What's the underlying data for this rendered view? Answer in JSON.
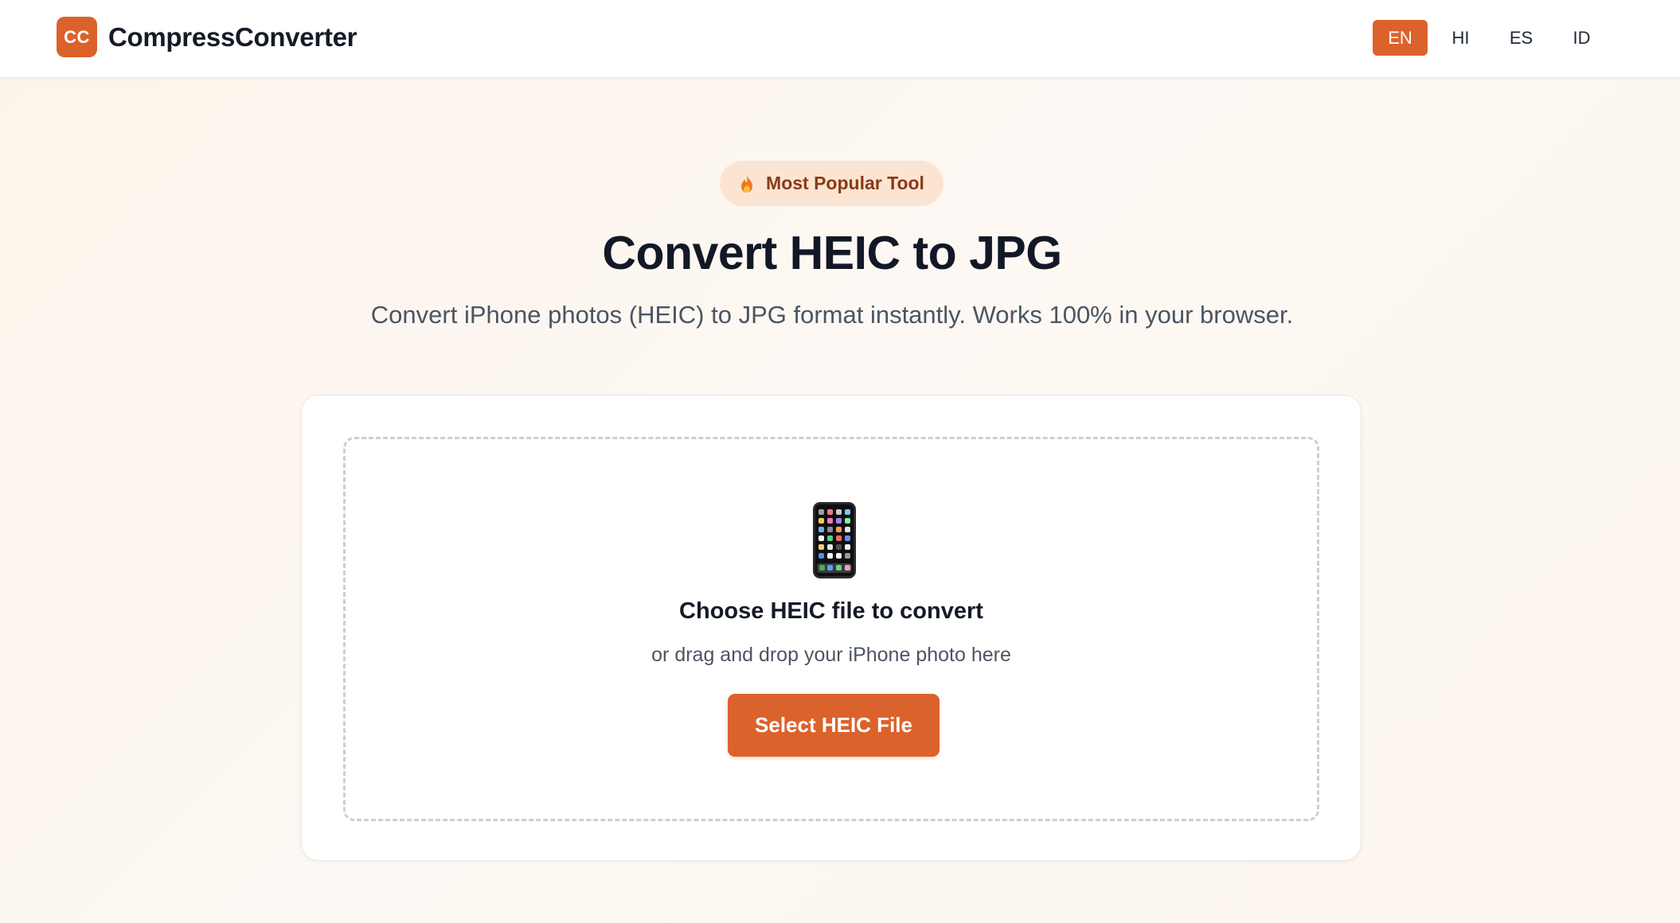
{
  "header": {
    "logo_text": "CC",
    "brand_name": "CompressConverter",
    "languages": [
      {
        "label": "EN",
        "active": true
      },
      {
        "label": "HI",
        "active": false
      },
      {
        "label": "ES",
        "active": false
      },
      {
        "label": "ID",
        "active": false
      }
    ]
  },
  "hero": {
    "badge_icon": "fire-icon",
    "badge_label": "Most Popular Tool",
    "title": "Convert HEIC to JPG",
    "subtitle": "Convert iPhone photos (HEIC) to JPG format instantly. Works 100% in your browser."
  },
  "upload": {
    "icon": "mobile-phone-icon",
    "title": "Choose HEIC file to convert",
    "subtitle": "or drag and drop your iPhone photo here",
    "button_label": "Select HEIC File"
  },
  "colors": {
    "accent": "#dc622c",
    "badge_bg": "#fbe5d2",
    "badge_text": "#8a3a17",
    "heading": "#121826",
    "muted": "#4b5563"
  }
}
